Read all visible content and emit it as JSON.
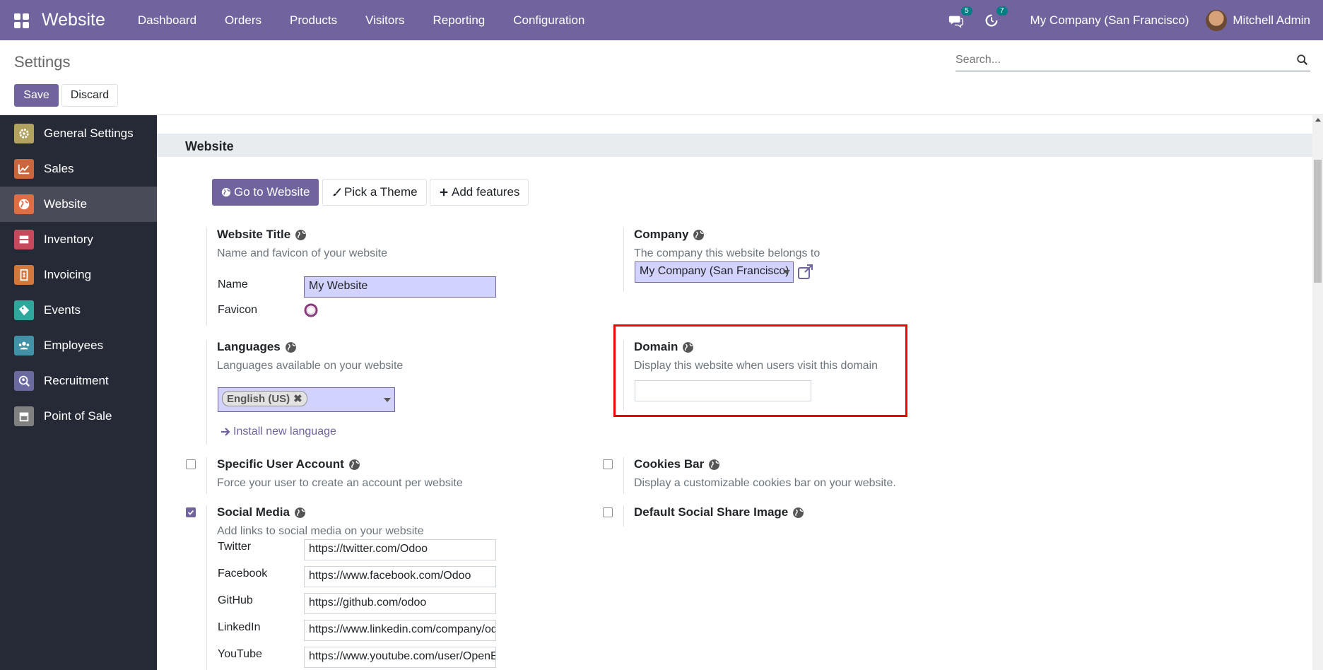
{
  "topnav": {
    "brand": "Website",
    "menu": [
      "Dashboard",
      "Orders",
      "Products",
      "Visitors",
      "Reporting",
      "Configuration"
    ],
    "messages_count": "5",
    "activities_count": "7",
    "company": "My Company (San Francisco)",
    "user": "Mitchell Admin"
  },
  "control": {
    "title": "Settings",
    "save_label": "Save",
    "discard_label": "Discard",
    "search_placeholder": "Search..."
  },
  "sidebar": {
    "items": [
      {
        "label": "General Settings",
        "icon": "gear-icon",
        "color": "#b1a35f"
      },
      {
        "label": "Sales",
        "icon": "chart-line-icon",
        "color": "#c9663d"
      },
      {
        "label": "Website",
        "icon": "globe-icon",
        "color": "#e06e44"
      },
      {
        "label": "Inventory",
        "icon": "boxes-icon",
        "color": "#c74a5c"
      },
      {
        "label": "Invoicing",
        "icon": "invoice-icon",
        "color": "#d2783d"
      },
      {
        "label": "Events",
        "icon": "ticket-icon",
        "color": "#2fa79d"
      },
      {
        "label": "Employees",
        "icon": "users-icon",
        "color": "#4192a6"
      },
      {
        "label": "Recruitment",
        "icon": "search-person-icon",
        "color": "#6a6aa1"
      },
      {
        "label": "Point of Sale",
        "icon": "shop-icon",
        "color": "#808080"
      }
    ]
  },
  "main": {
    "section_title": "Website",
    "buttons": {
      "go_to_website": "Go to Website",
      "pick_theme": "Pick a Theme",
      "add_features": "Add features"
    },
    "website_title": {
      "title": "Website Title",
      "desc": "Name and favicon of your website",
      "name_label": "Name",
      "name_value": "My Website",
      "favicon_label": "Favicon"
    },
    "company": {
      "title": "Company",
      "desc": "The company this website belongs to",
      "value": "My Company (San Francisco)"
    },
    "languages": {
      "title": "Languages",
      "desc": "Languages available on your website",
      "tag": "English (US)",
      "install_link": "Install new language"
    },
    "domain": {
      "title": "Domain",
      "desc": "Display this website when users visit this domain",
      "value": ""
    },
    "specific_user": {
      "title": "Specific User Account",
      "desc": "Force your user to create an account per website",
      "checked": false
    },
    "cookies_bar": {
      "title": "Cookies Bar",
      "desc": "Display a customizable cookies bar on your website.",
      "checked": false
    },
    "social_media": {
      "title": "Social Media",
      "desc": "Add links to social media on your website",
      "checked": true,
      "links": [
        {
          "label": "Twitter",
          "value": "https://twitter.com/Odoo"
        },
        {
          "label": "Facebook",
          "value": "https://www.facebook.com/Odoo"
        },
        {
          "label": "GitHub",
          "value": "https://github.com/odoo"
        },
        {
          "label": "LinkedIn",
          "value": "https://www.linkedin.com/company/odoo"
        },
        {
          "label": "YouTube",
          "value": "https://www.youtube.com/user/OpenERPonline"
        }
      ]
    },
    "default_share": {
      "title": "Default Social Share Image",
      "checked": false
    }
  },
  "colors": {
    "brand": "#71639e",
    "sidebar_bg": "#262a36",
    "highlight": "#e00000"
  }
}
